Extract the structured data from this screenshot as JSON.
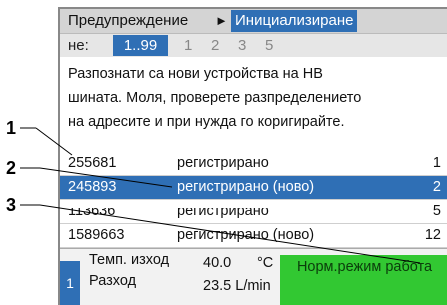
{
  "header": {
    "warning": "Предупреждение",
    "arrow": "►",
    "current": "Инициализиране"
  },
  "pager": {
    "label": "не:",
    "selected": "1..99",
    "pages": [
      "1",
      "2",
      "3",
      "5"
    ]
  },
  "message": [
    "Разпознати са нови устройства на HB",
    "шината. Моля, проверете разпределението",
    "на адресите и при нужда го коригирайте."
  ],
  "devices": [
    {
      "id": "255681",
      "status": "регистрирано",
      "num": "1"
    },
    {
      "id": "245893",
      "status": "регистрирано (ново)",
      "num": "2"
    },
    {
      "id": "113636",
      "status": "регистрирано",
      "num": "5"
    },
    {
      "id": "1589663",
      "status": "регистрирано (ново)",
      "num": "12"
    }
  ],
  "statusbar": {
    "channel": "1",
    "temp_label": "Темп. изход",
    "temp_value": "40.0",
    "temp_unit": "°C",
    "flow_label": "Разход",
    "flow_value": "23.5 L/min",
    "mode": "Норм.режим работа"
  },
  "callouts": [
    "1",
    "2",
    "3"
  ],
  "colors": {
    "accent": "#2f6fb5",
    "mode_bg": "#32c832",
    "title_bg": "#d4d4d4"
  }
}
